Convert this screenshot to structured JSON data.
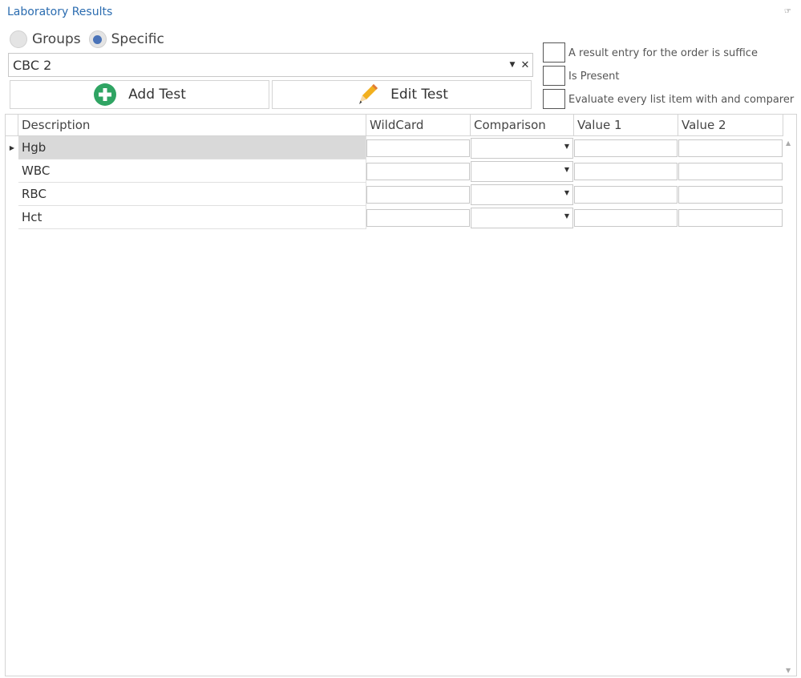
{
  "panel": {
    "title": "Laboratory Results",
    "pin_icon": "pin-icon"
  },
  "mode": {
    "options": [
      {
        "label": "Groups",
        "selected": false
      },
      {
        "label": "Specific",
        "selected": true
      }
    ]
  },
  "test_selector": {
    "value": "CBC 2"
  },
  "buttons": {
    "add_test": "Add Test",
    "edit_test": "Edit Test"
  },
  "options": [
    {
      "label": "A result entry for the order is suffice",
      "checked": false
    },
    {
      "label": "Is Present",
      "checked": false
    },
    {
      "label": "Evaluate every list item with and comparer",
      "checked": false
    }
  ],
  "grid": {
    "columns": [
      "Description",
      "WildCard",
      "Comparison",
      "Value 1",
      "Value 2"
    ],
    "rows": [
      {
        "description": "Hgb",
        "wildcard": "",
        "comparison": "",
        "value1": "",
        "value2": "",
        "current": true
      },
      {
        "description": "WBC",
        "wildcard": "",
        "comparison": "",
        "value1": "",
        "value2": "",
        "current": false
      },
      {
        "description": "RBC",
        "wildcard": "",
        "comparison": "",
        "value1": "",
        "value2": "",
        "current": false
      },
      {
        "description": "Hct",
        "wildcard": "",
        "comparison": "",
        "value1": "",
        "value2": "",
        "current": false
      }
    ]
  },
  "colors": {
    "title": "#2b6cb0",
    "radio_selected": "#4a73b8",
    "add_icon": "#2fa463",
    "edit_icon": "#f2b01e",
    "selected_row": "#d9d9d9"
  }
}
